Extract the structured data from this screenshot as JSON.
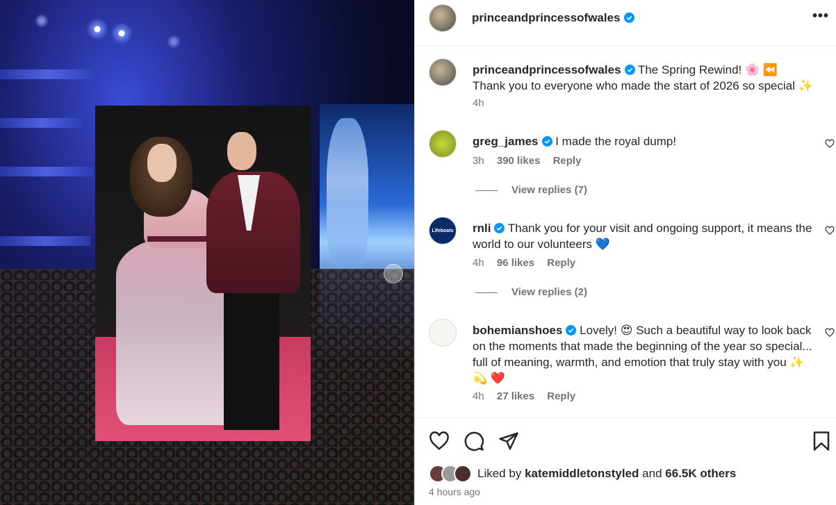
{
  "post": {
    "username": "princeandprincessofwales",
    "more_label": "•••"
  },
  "caption": {
    "username": "princeandprincessofwales",
    "line1": "The Spring Rewind! 🌸 ⏪",
    "line2": "Thank you to everyone who made the start of 2026 so special ✨",
    "time": "4h"
  },
  "comments": [
    {
      "username": "greg_james",
      "text": "I made the royal dump!",
      "time": "3h",
      "likes": "390 likes",
      "reply": "Reply",
      "view_replies": "View replies (7)"
    },
    {
      "username": "rnli",
      "text": "Thank you for your visit and ongoing support, it means the world to our volunteers 💙",
      "avatar_text": "Lifeboats",
      "time": "4h",
      "likes": "96 likes",
      "reply": "Reply",
      "view_replies": "View replies (2)"
    },
    {
      "username": "bohemianshoes",
      "text": "Lovely! 😍 Such a beautiful way to look back on the moments that made the beginning of the year so special... full of meaning, warmth, and emotion that truly stay with you ✨ 💫 ❤️",
      "time": "4h",
      "likes": "27 likes",
      "reply": "Reply"
    }
  ],
  "likes": {
    "prefix": "Liked by",
    "user": "katemiddletonstyled",
    "and": "and",
    "others": "66.5K others"
  },
  "timestamp": "4 hours ago",
  "colors": {
    "verified": "#0095f6",
    "meta_gray": "#737373",
    "text": "#262626"
  },
  "icons": [
    "heart-icon",
    "comment-icon",
    "share-icon",
    "bookmark-icon",
    "verified-icon",
    "more-icon"
  ]
}
